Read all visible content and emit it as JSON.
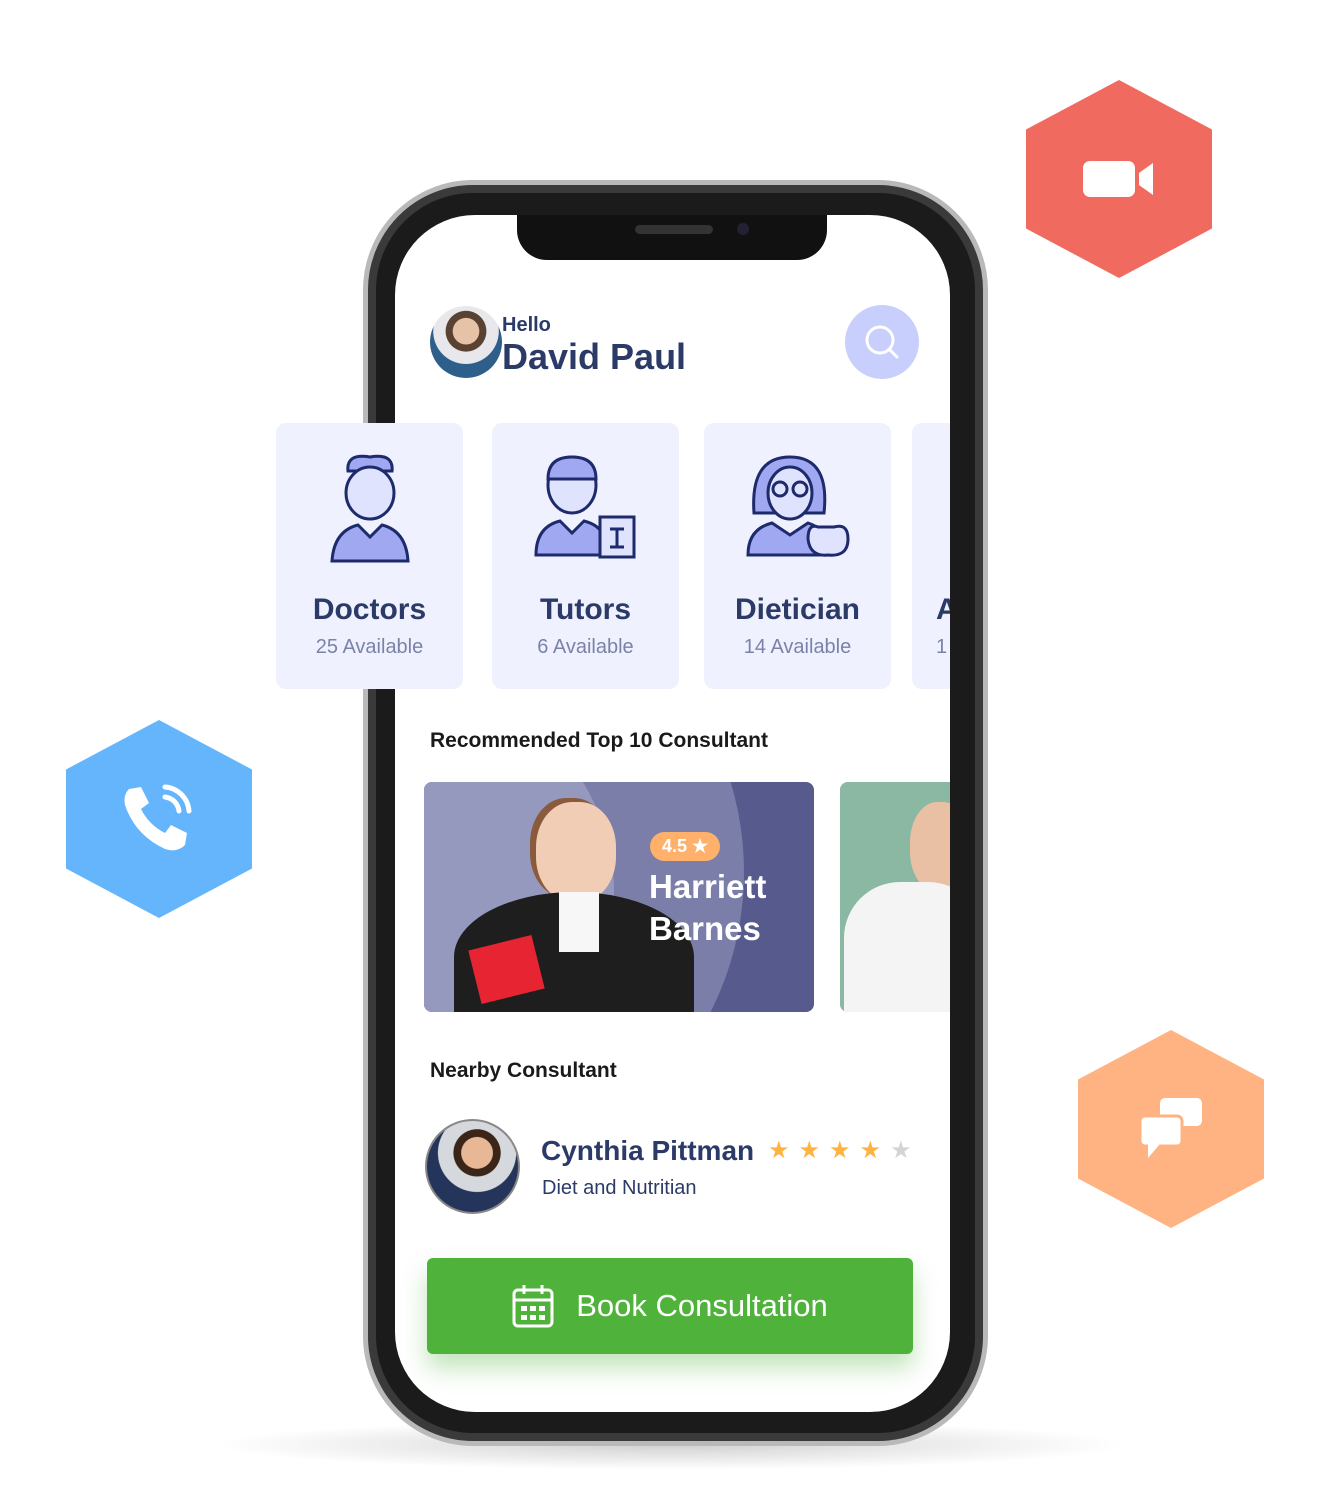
{
  "header": {
    "greeting": "Hello",
    "user_name": "David Paul"
  },
  "categories": [
    {
      "name": "Doctors",
      "available": "25  Available",
      "icon": "doctor-icon"
    },
    {
      "name": "Tutors",
      "available": "6 Available",
      "icon": "tutor-icon"
    },
    {
      "name": "Dietician",
      "available": "14  Available",
      "icon": "dietician-icon"
    },
    {
      "name": "A",
      "available": "1",
      "icon": ""
    }
  ],
  "recommended": {
    "title": "Recommended Top 10 Consultant",
    "featured": {
      "rating": "4.5 ★",
      "first_name": "Harriett",
      "last_name": "Barnes"
    }
  },
  "nearby": {
    "title": "Nearby Consultant",
    "name": "Cynthia Pittman",
    "specialty": "Diet and Nutritian",
    "rating": 4,
    "max_rating": 5
  },
  "cta": {
    "label": "Book Consultation"
  },
  "colors": {
    "video": "#f06a5f",
    "call": "#64b5fb",
    "chat": "#ffb382",
    "accent": "#2b3a67",
    "button": "#4fb23b",
    "search_bg": "#c8cffc"
  }
}
